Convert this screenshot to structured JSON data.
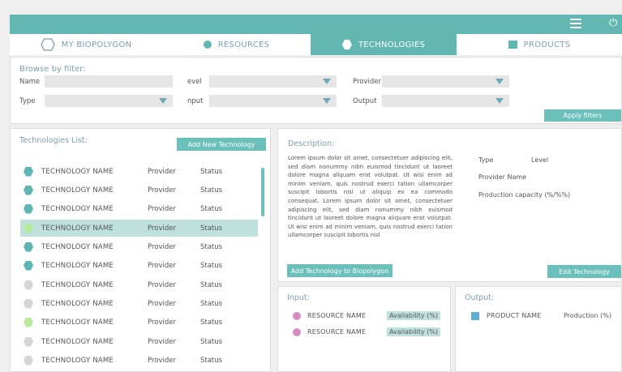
{
  "tabs": [
    {
      "label": "MY BIOPOLYGON",
      "icon": "hexagon-outline-icon"
    },
    {
      "label": "RESOURCES",
      "icon": "circle-icon"
    },
    {
      "label": "TECHNOLOGIES",
      "icon": "hexagon-icon"
    },
    {
      "label": "PRODUCTS",
      "icon": "square-icon"
    }
  ],
  "filter": {
    "title": "Browse by filter:",
    "name_label": "Name",
    "level_label": "evel",
    "provider_label": "Provider",
    "type_label": "Type",
    "input_label": "nput",
    "output_label": "Output",
    "apply_button": "Apply filters"
  },
  "list": {
    "title": "Technologies List:",
    "add_button": "Add New Technology",
    "rows": [
      {
        "name": "TECHNOLOGY NAME",
        "provider": "Provider",
        "status": "Status",
        "color": "#5db6b5"
      },
      {
        "name": "TECHNOLOGY NAME",
        "provider": "Provider",
        "status": "Status",
        "color": "#5db6b5"
      },
      {
        "name": "TECHNOLOGY NAME",
        "provider": "Provider",
        "status": "Status",
        "color": "#5db6b5"
      },
      {
        "name": "TECHNOLOGY NAME",
        "provider": "Provider",
        "status": "Status",
        "color": "#b8ea9c"
      },
      {
        "name": "TECHNOLOGY NAME",
        "provider": "Provider",
        "status": "Status",
        "color": "#5db6b5"
      },
      {
        "name": "TECHNOLOGY NAME",
        "provider": "Provider",
        "status": "Status",
        "color": "#5db6b5"
      },
      {
        "name": "TECHNOLOGY NAME",
        "provider": "Provider",
        "status": "Status",
        "color": "#d6d6d6"
      },
      {
        "name": "TECHNOLOGY NAME",
        "provider": "Provider",
        "status": "Status",
        "color": "#d6d6d6"
      },
      {
        "name": "TECHNOLOGY NAME",
        "provider": "Provider",
        "status": "Status",
        "color": "#b8ea9c"
      },
      {
        "name": "TECHNOLOGY NAME",
        "provider": "Provider",
        "status": "Status",
        "color": "#d6d6d6"
      },
      {
        "name": "TECHNOLOGY NAME",
        "provider": "Provider",
        "status": "Status",
        "color": "#d6d6d6"
      }
    ]
  },
  "description": {
    "title": "Description:",
    "text": "Lorem ipsum dolor sit amet, consectetuer adipiscing elit, sed diam nonummy nibh euismod tincidunt ut laoreet dolore magna aliquam erat volutpat. Ut wisi enim ad minim veniam, quis nostrud exerci tation ullamcorper suscipit lobortis nisl ut aliquip ex ea commodo consequat. Lorem ipsum dolor sit amet, consectetuer adipiscing elit, sed diam nonummy nibh euismod tincidunt ut laoreet dolore magna aliquam erat volutpat. Ut wisi enim ad minim veniam, quis nostrud exerci tation ullamcorper suscipit lobortis nisl",
    "type_label": "Type",
    "level_label": "Level",
    "provider_label": "Provider Name",
    "capacity_label": "Production capacity (%/%%)",
    "add_button": "Add Technology to Biopolygon",
    "edit_button": "Edit Technology"
  },
  "input": {
    "title": "Input:",
    "rows": [
      {
        "name": "RESOURCE NAME",
        "value": "Availability (%)"
      },
      {
        "name": "RESOURCE NAME",
        "value": "Availability (%)"
      }
    ]
  },
  "output": {
    "title": "Output:",
    "rows": [
      {
        "name": "PRODUCT NAME",
        "value": "Production (%)"
      }
    ]
  }
}
